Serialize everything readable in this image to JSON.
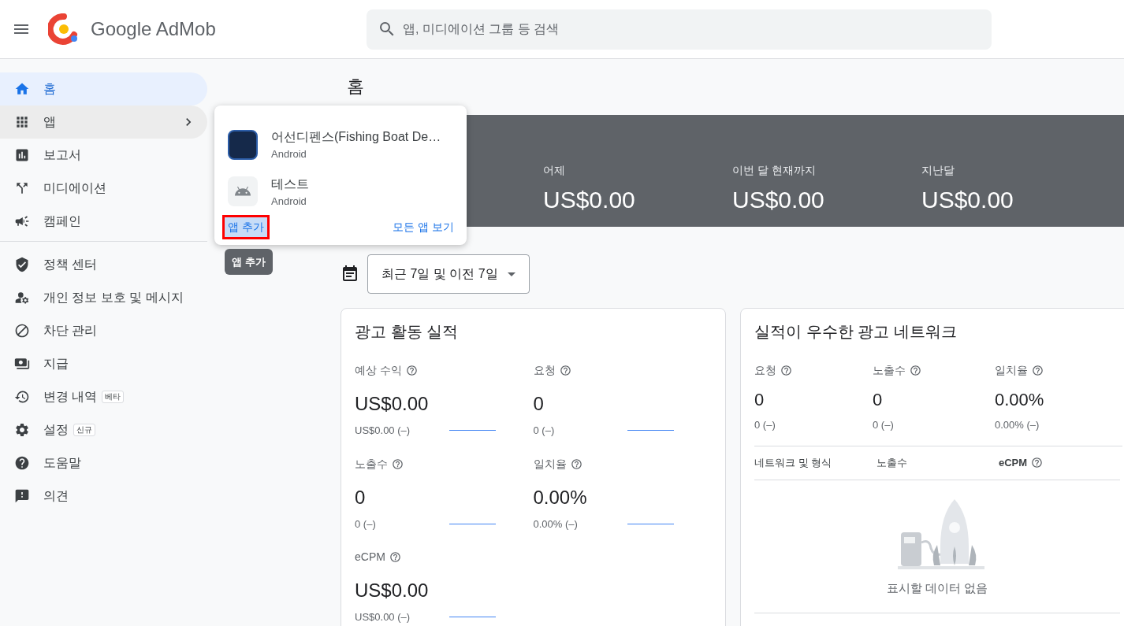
{
  "header": {
    "brand": "Google AdMob",
    "search": {
      "placeholder": "앱, 미디에이션 그룹 등 검색"
    }
  },
  "sidebar": {
    "sections": [
      [
        {
          "label": "홈",
          "selected": true,
          "expanded": false,
          "has_submenu": false
        },
        {
          "label": "앱",
          "selected": false,
          "expanded": true,
          "has_submenu": true
        },
        {
          "label": "보고서",
          "selected": false,
          "expanded": false,
          "has_submenu": false
        },
        {
          "label": "미디에이션",
          "selected": false,
          "expanded": false,
          "has_submenu": false
        },
        {
          "label": "캠페인",
          "selected": false,
          "expanded": false,
          "has_submenu": false
        }
      ],
      [
        {
          "label": "정책 센터",
          "selected": false,
          "expanded": false,
          "has_submenu": false
        },
        {
          "label": "개인 정보 보호 및 메시지",
          "selected": false,
          "expanded": false,
          "has_submenu": false
        },
        {
          "label": "차단 관리",
          "selected": false,
          "expanded": false,
          "has_submenu": false
        },
        {
          "label": "지급",
          "selected": false,
          "expanded": false,
          "has_submenu": false
        },
        {
          "label": "변경 내역",
          "selected": false,
          "expanded": false,
          "has_submenu": false,
          "badge": "베타"
        },
        {
          "label": "설정",
          "selected": false,
          "expanded": false,
          "has_submenu": false,
          "badge": "신규"
        },
        {
          "label": "도움말",
          "selected": false,
          "expanded": false,
          "has_submenu": false
        },
        {
          "label": "의견",
          "selected": false,
          "expanded": false,
          "has_submenu": false
        }
      ]
    ]
  },
  "page_title": "홈",
  "summary": [
    {
      "label": "어제",
      "value": "US$0.00"
    },
    {
      "label": "이번 달 현재까지",
      "value": "US$0.00"
    },
    {
      "label": "지난달",
      "value": "US$0.00"
    }
  ],
  "date_range": {
    "label": "최근 7일 및 이전 7일"
  },
  "performance": {
    "title": "광고 활동 실적",
    "metrics": [
      {
        "label": "예상 수익",
        "value": "US$0.00",
        "comparison": "US$0.00 (–)"
      },
      {
        "label": "요청",
        "value": "0",
        "comparison": "0 (–)"
      },
      {
        "label": "노출수",
        "value": "0",
        "comparison": "0 (–)"
      },
      {
        "label": "일치율",
        "value": "0.00%",
        "comparison": "0.00% (–)"
      },
      {
        "label": "eCPM",
        "value": "US$0.00",
        "comparison": "US$0.00 (–)"
      }
    ]
  },
  "networks": {
    "title": "실적이 우수한 광고 네트워크",
    "metrics": [
      {
        "label": "요청",
        "value": "0",
        "comparison": "0 (–)"
      },
      {
        "label": "노출수",
        "value": "0",
        "comparison": "0 (–)"
      },
      {
        "label": "일치율",
        "value": "0.00%",
        "comparison": "0.00% (–)"
      }
    ],
    "columns": [
      {
        "label": "네트워크 및 형식",
        "help": false,
        "bold": false
      },
      {
        "label": "노출수",
        "help": false,
        "bold": false
      },
      {
        "label": "eCPM",
        "help": true,
        "bold": true
      }
    ],
    "empty_text": "표시할 데이터 없음"
  },
  "apps_menu": {
    "apps": [
      {
        "name": "어선디펜스(Fishing Boat De…",
        "platform": "Android",
        "kind": "image"
      },
      {
        "name": "테스트",
        "platform": "Android",
        "kind": "android"
      }
    ],
    "add_link": "앱 추가",
    "all_link": "모든 앱 보기",
    "tooltip": "앱 추가"
  }
}
